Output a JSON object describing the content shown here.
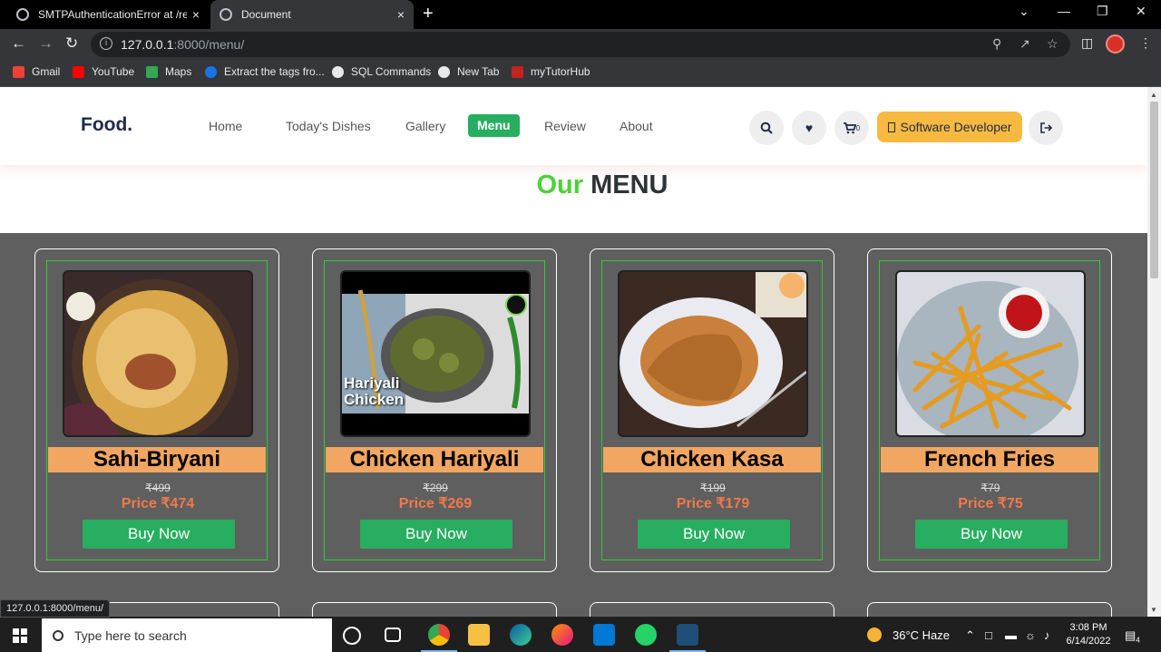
{
  "browser": {
    "tabs": [
      {
        "title": "SMTPAuthenticationError at /reg",
        "close": "×"
      },
      {
        "title": "Document",
        "close": "×"
      }
    ],
    "new_tab": "+",
    "window_controls": {
      "chevron": "⌄",
      "minimize": "—",
      "restore": "❐",
      "close": "✕"
    },
    "url_host": "127.0.0.1",
    "url_rest": ":8000/menu/",
    "bookmarks": [
      {
        "label": "Gmail",
        "color": "#ea4335"
      },
      {
        "label": "YouTube",
        "color": "#ff0000"
      },
      {
        "label": "Maps",
        "color": "#34a853"
      },
      {
        "label": "Extract the tags fro...",
        "color": "#1a73e8"
      },
      {
        "label": "SQL Commands",
        "color": "#e8eaed"
      },
      {
        "label": "New Tab",
        "color": "#e8eaed"
      },
      {
        "label": "myTutorHub",
        "color": "#c5221f"
      }
    ],
    "status_url": "127.0.0.1:8000/menu/"
  },
  "site": {
    "logo": "Food.",
    "nav": [
      "Home",
      "Today's Dishes",
      "Gallery",
      "Menu",
      "Review",
      "About"
    ],
    "cart_count": "0",
    "user_button": "Software Developer",
    "heading_our": "Our",
    "heading_menu": "MENU",
    "items": [
      {
        "name": "Sahi-Biryani",
        "old_price": "₹499",
        "price": "Price ₹474",
        "buy": "Buy Now"
      },
      {
        "name": "Chicken Hariyali",
        "old_price": "₹299",
        "price": "Price ₹269",
        "buy": "Buy Now",
        "photo_caption": "Hariyali Chicken"
      },
      {
        "name": "Chicken Kasa",
        "old_price": "₹199",
        "price": "Price ₹179",
        "buy": "Buy Now"
      },
      {
        "name": "French Fries",
        "old_price": "₹79",
        "price": "Price ₹75",
        "buy": "Buy Now"
      }
    ]
  },
  "taskbar": {
    "search_placeholder": "Type here to search",
    "weather": "36°C  Haze",
    "time": "3:08 PM",
    "date": "6/14/2022",
    "notifications": "4"
  },
  "colors": {
    "accent_green": "#27ae60",
    "heading_green": "#4cd137",
    "price_orange": "#f07a4a",
    "name_band": "#f1a661",
    "user_button": "#f8b940"
  }
}
